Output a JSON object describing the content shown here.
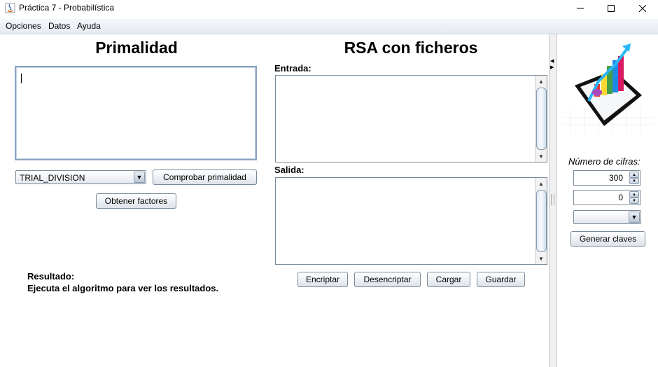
{
  "window": {
    "title": "Práctica 7 - Probabilística",
    "controls": {
      "minimize": "—",
      "maximize": "☐",
      "close": "✕"
    }
  },
  "menu": {
    "items": [
      "Opciones",
      "Datos",
      "Ayuda"
    ]
  },
  "primality": {
    "title": "Primalidad",
    "algorithm_selected": "TRIAL_DIVISION",
    "check_button": "Comprobar primalidad",
    "factors_button": "Obtener factores",
    "result_label": "Resultado:",
    "result_text": "Ejecuta el algoritmo para ver los resultados."
  },
  "rsa": {
    "title": "RSA con ficheros",
    "input_label": "Entrada:",
    "output_label": "Salida:",
    "buttons": {
      "encrypt": "Encriptar",
      "decrypt": "Desencriptar",
      "load": "Cargar",
      "save": "Guardar"
    }
  },
  "keys": {
    "digits_label": "Número de cifras:",
    "digits_value": "300",
    "second_value": "0",
    "combo_selected": "",
    "generate_button": "Generar claves"
  }
}
